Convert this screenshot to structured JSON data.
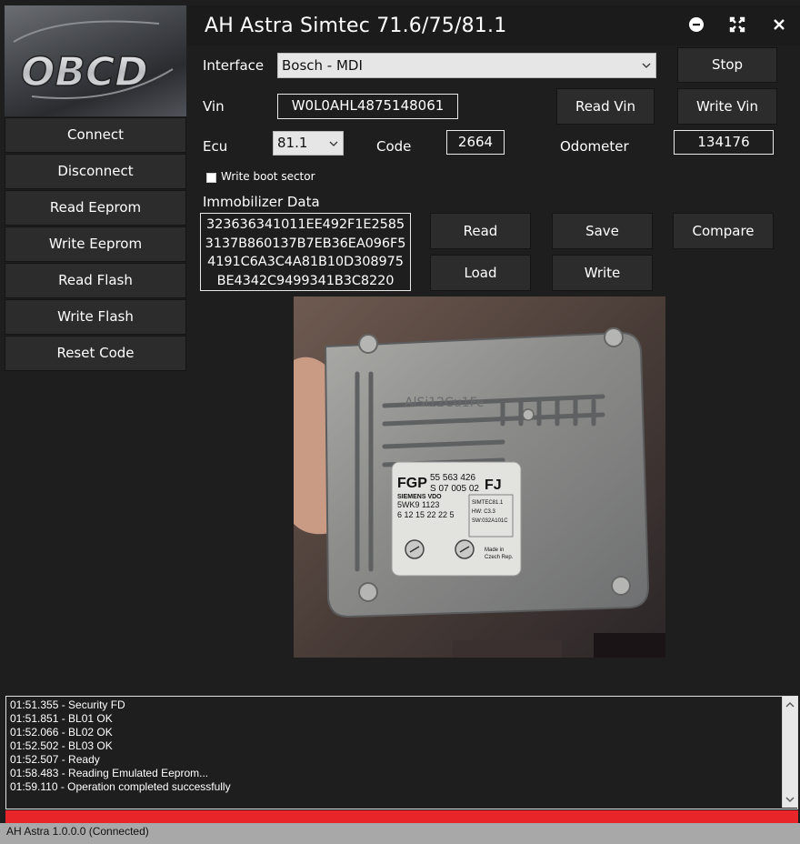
{
  "app": {
    "title": "AH Astra Simtec 71.6/75/81.1",
    "logo_text": "OBCD"
  },
  "sidebar": {
    "items": [
      {
        "label": "Connect"
      },
      {
        "label": "Disconnect"
      },
      {
        "label": "Read Eeprom"
      },
      {
        "label": "Write Eeprom"
      },
      {
        "label": "Read Flash"
      },
      {
        "label": "Write Flash"
      },
      {
        "label": "Reset Code"
      }
    ]
  },
  "window_controls": {
    "minimize_icon": "minus-circle-icon",
    "maximize_icon": "expand-icon",
    "close_icon": "close-icon"
  },
  "form": {
    "interface_label": "Interface",
    "interface_value": "Bosch - MDI",
    "stop_label": "Stop",
    "vin_label": "Vin",
    "vin_value": "W0L0AHL4875148061",
    "read_vin_label": "Read Vin",
    "write_vin_label": "Write Vin",
    "ecu_label": "Ecu",
    "ecu_value": "81.1",
    "code_label": "Code",
    "code_value": "2664",
    "odometer_label": "Odometer",
    "odometer_value": "134176",
    "boot_sector_label": "Write boot sector",
    "boot_sector_checked": false
  },
  "immobilizer": {
    "label": "Immobilizer Data",
    "lines": [
      "323636341011EE492F1E2585",
      "3137B860137B7EB36EA096F5",
      "4191C6A3C4A81B10D308975",
      "BE4342C9499341B3C8220"
    ],
    "read_label": "Read",
    "save_label": "Save",
    "compare_label": "Compare",
    "load_label": "Load",
    "write_label": "Write"
  },
  "ecu_photo": {
    "label_brand": "FGP",
    "label_part": "55 563 426",
    "label_sub": "S 07 005  02",
    "label_code": "FJ",
    "label_maker": "SIEMENS VDO",
    "label_model": "5WK9 1123",
    "label_serial": "6 12 15 22 22 5",
    "label_hw1": "SIMTEC81.1",
    "label_hw2": "HW: C3.3",
    "label_hw3": "SW:032A101C",
    "label_origin1": "Made in",
    "label_origin2": "Czech Rep.",
    "casting_text": "AlSi12Cu1Fe"
  },
  "log": {
    "lines": [
      "01:51.355 - Security FD",
      "01:51.851 - BL01 OK",
      "01:52.066 - BL02 OK",
      "01:52.502 - BL03 OK",
      "01:52.507 - Ready",
      "01:58.483 - Reading Emulated Eeprom...",
      "01:59.110 - Operation completed successfully"
    ]
  },
  "progress": {
    "fraction": 1.0,
    "color": "#e8262a"
  },
  "status": {
    "text": "AH Astra 1.0.0.0 (Connected)"
  },
  "colors": {
    "background": "#1e1e1e",
    "button": "#2c2c2c",
    "progress_red": "#e8262a",
    "statusbar": "#a8a8a8"
  }
}
